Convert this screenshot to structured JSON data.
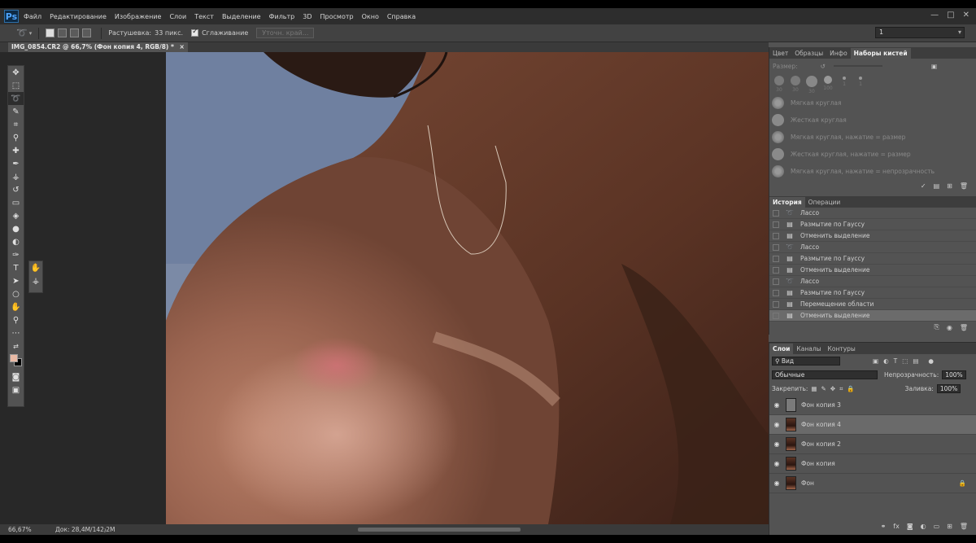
{
  "app": {
    "logo": "Ps"
  },
  "menu": [
    "Файл",
    "Редактирование",
    "Изображение",
    "Слои",
    "Текст",
    "Выделение",
    "Фильтр",
    "3D",
    "Просмотр",
    "Окно",
    "Справка"
  ],
  "window_controls": [
    "—",
    "□",
    "✕"
  ],
  "options": {
    "feather_label": "Растушевка:",
    "feather_value": "33 пикс.",
    "antialias_label": "Сглаживание",
    "refine_edge": "Уточн. край...",
    "workspace_value": "1"
  },
  "document": {
    "tab_title": "IMG_0854.CR2 @ 66,7% (Фон копия 4, RGB/8) *",
    "close_icon": "×",
    "zoom": "66,67%",
    "doc_size": "Док: 28,4M/142,2M"
  },
  "brush_panel": {
    "tabs": [
      "Цвет",
      "Образцы",
      "Инфо",
      "Наборы кистей"
    ],
    "active_tab": "Наборы кистей",
    "size_label": "Размер:",
    "presets": [
      "Мягкая круглая",
      "Жесткая круглая",
      "Мягкая круглая, нажатие = размер",
      "Жесткая круглая, нажатие = размер",
      "Мягкая круглая, нажатие = непрозрачность"
    ],
    "preset_sizes": [
      "30",
      "30",
      "30",
      "100",
      "1",
      "1"
    ]
  },
  "history_panel": {
    "tabs": [
      "История",
      "Операции"
    ],
    "active_tab": "История",
    "items": [
      {
        "icon": "lasso-icon",
        "label": "Лассо"
      },
      {
        "icon": "doc-icon",
        "label": "Размытие по Гауссу"
      },
      {
        "icon": "doc-icon",
        "label": "Отменить выделение"
      },
      {
        "icon": "lasso-icon",
        "label": "Лассо"
      },
      {
        "icon": "doc-icon",
        "label": "Размытие по Гауссу"
      },
      {
        "icon": "doc-icon",
        "label": "Отменить выделение"
      },
      {
        "icon": "lasso-icon",
        "label": "Лассо"
      },
      {
        "icon": "doc-icon",
        "label": "Размытие по Гауссу"
      },
      {
        "icon": "doc-icon",
        "label": "Перемещение области"
      },
      {
        "icon": "doc-icon",
        "label": "Отменить выделение"
      }
    ],
    "selected_index": 9
  },
  "layers_panel": {
    "tabs": [
      "Слои",
      "Каналы",
      "Контуры"
    ],
    "active_tab": "Слои",
    "filter_label": "Вид",
    "blend_mode": "Обычные",
    "opacity_label": "Непрозрачность:",
    "opacity_value": "100%",
    "lock_label": "Закрепить:",
    "fill_label": "Заливка:",
    "fill_value": "100%",
    "layers": [
      {
        "name": "Фон копия 3",
        "thumb": "gray",
        "selected": false,
        "locked": false
      },
      {
        "name": "Фон копия 4",
        "thumb": "photo",
        "selected": true,
        "locked": false
      },
      {
        "name": "Фон копия 2",
        "thumb": "photo",
        "selected": false,
        "locked": false
      },
      {
        "name": "Фон копия",
        "thumb": "photo",
        "selected": false,
        "locked": false
      },
      {
        "name": "Фон",
        "thumb": "photo",
        "selected": false,
        "locked": true
      }
    ]
  },
  "colors": {
    "foreground": "#e8b9a5",
    "background": "#000000",
    "selection_border": "#d8c8b8"
  }
}
